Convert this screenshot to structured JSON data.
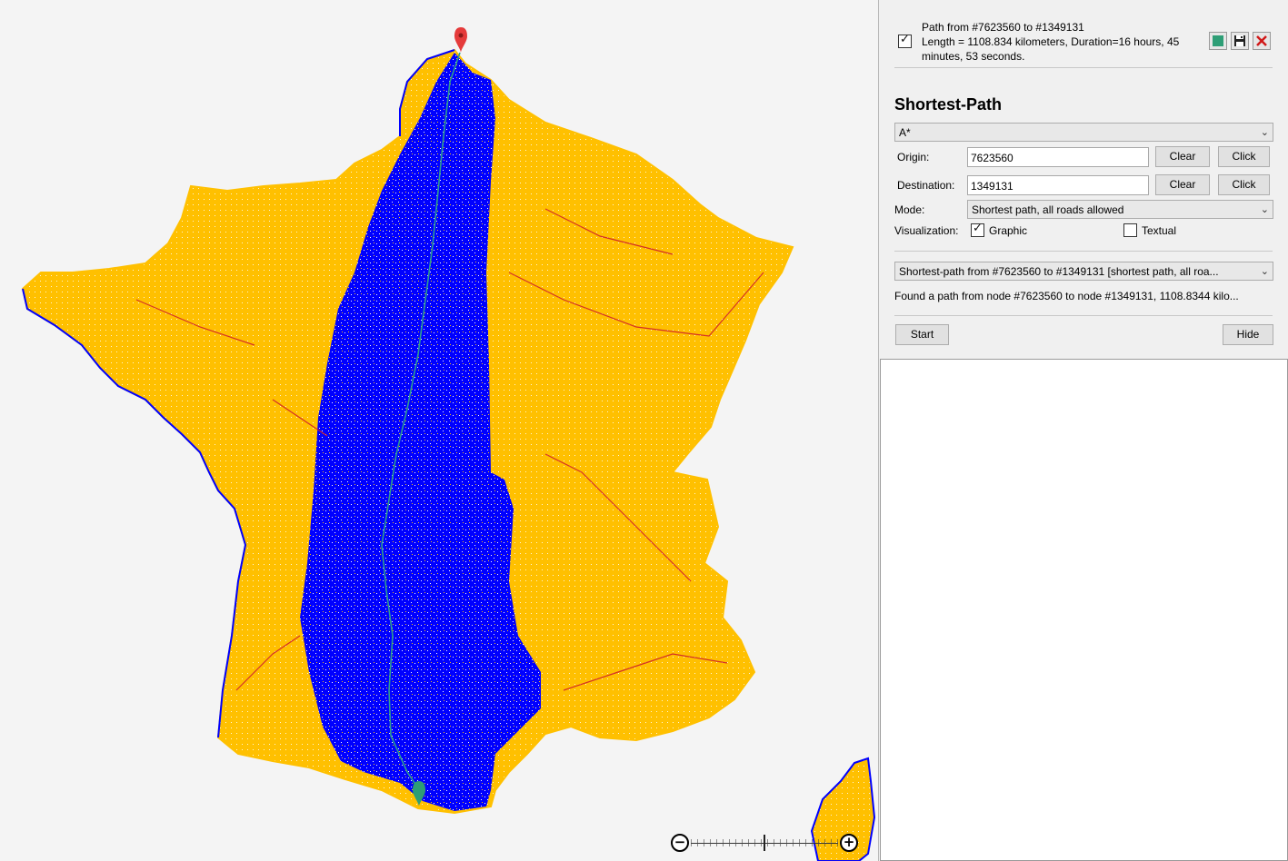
{
  "map": {
    "origin_marker_color": "#e53b3b",
    "destination_marker_color": "#2e9e76",
    "road_color": "#ffc000",
    "explored_color": "#0000ff",
    "path_color": "#2e9e8e",
    "highway_color": "#d0202a"
  },
  "result": {
    "checked": true,
    "line1": "Path from #7623560 to #1349131",
    "line2": "Length = 1108.834 kilometers, Duration=16 hours, 45",
    "line3": "minutes, 53 seconds.",
    "color_icon": "color-swatch-icon",
    "save_icon": "save-icon",
    "delete_icon": "delete-icon"
  },
  "panel": {
    "title": "Shortest-Path",
    "algorithm": "A*",
    "origin_label": "Origin:",
    "origin_value": "7623560",
    "destination_label": "Destination:",
    "destination_value": "1349131",
    "clear_label": "Clear",
    "click_label": "Click",
    "mode_label": "Mode:",
    "mode_value": "Shortest path, all roads allowed",
    "visualization_label": "Visualization:",
    "graphic_label": "Graphic",
    "graphic_checked": true,
    "textual_label": "Textual",
    "textual_checked": false,
    "result_select": "Shortest-path from #7623560 to #1349131 [shortest path, all roa...",
    "status": "Found a path from node #7623560 to node #1349131, 1108.8344 kilo...",
    "start_label": "Start",
    "hide_label": "Hide"
  }
}
